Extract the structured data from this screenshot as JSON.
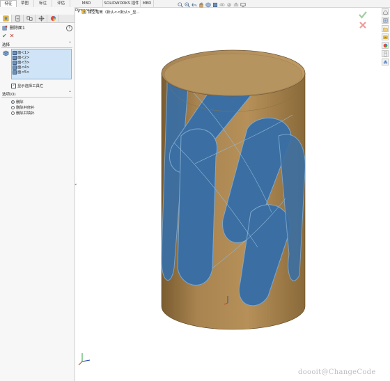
{
  "command_tabs": [
    "特征",
    "草图",
    "标注",
    "评估",
    "MBD Dimensions",
    "SOLIDWORKS 插件",
    "MBD"
  ],
  "active_tab_index": 0,
  "property_manager": {
    "title": "删除面1",
    "help": "?",
    "ok_symbol": "✔",
    "cancel_symbol": "✕",
    "selection_group": "选择",
    "selected_faces": [
      "面<1>",
      "面<2>",
      "面<3>",
      "面<4>",
      "面<5>"
    ],
    "show_toolbar_label": "显示选择工具栏",
    "show_toolbar_checked": true,
    "options_group": "选项(O)",
    "options": [
      {
        "label": "删除",
        "selected": true
      },
      {
        "label": "删除并修补",
        "selected": false
      },
      {
        "label": "删除并填补",
        "selected": false
      }
    ]
  },
  "breadcrumb": {
    "text": "镂空笔筒（默认<<默认>_显..."
  },
  "hud_icons": [
    "zoom-to-fit",
    "zoom-area",
    "previous-view",
    "section-view",
    "view-orientation",
    "display-style",
    "hide-show",
    "edit-appearance",
    "apply-scene",
    "view-settings"
  ],
  "task_pane_icons": [
    "home",
    "design-library",
    "file-explorer",
    "view-palette",
    "appearances",
    "custom-properties",
    "forum"
  ],
  "colors": {
    "body": "#a37f4b",
    "faces": "#3b6fa3",
    "edges": "#7ea7cc",
    "accent": "#1a6bb8"
  },
  "watermark": "doooit@ChangeCode"
}
